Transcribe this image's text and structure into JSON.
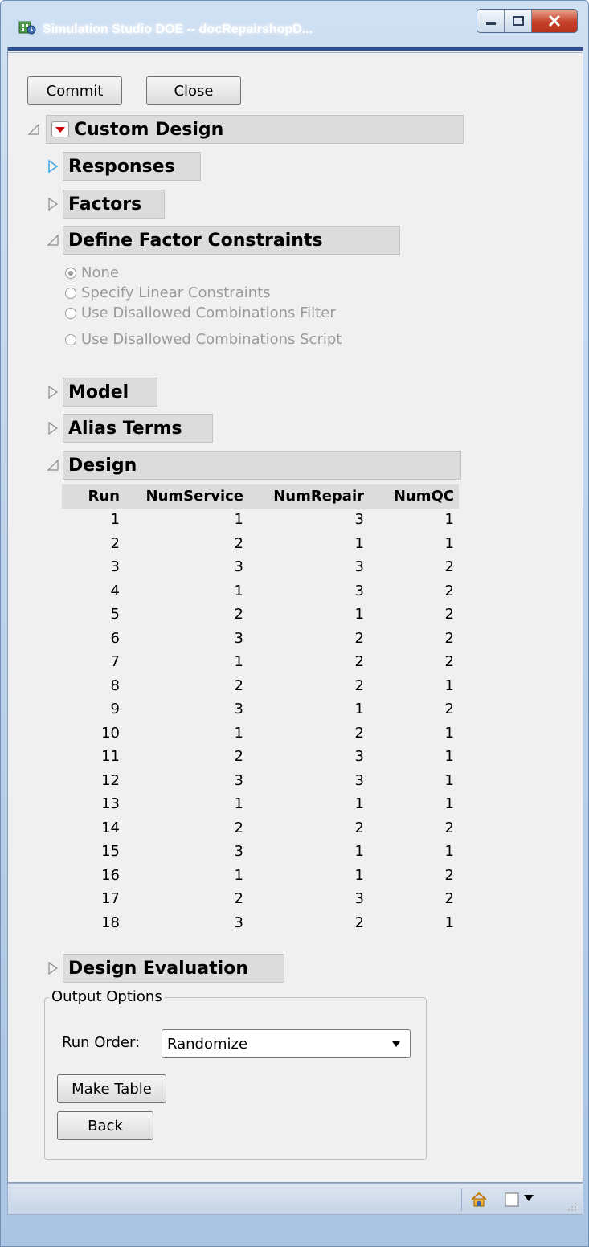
{
  "window": {
    "title": "Simulation Studio DOE -- docRepairshopD...",
    "controls": [
      "minimize",
      "maximize",
      "close"
    ],
    "accent": "#2f4f8f"
  },
  "toolbar": {
    "commit_label": "Commit",
    "close_label": "Close"
  },
  "outline": {
    "custom_design": "Custom Design",
    "responses": "Responses",
    "factors": "Factors",
    "define_factor_constraints": "Define Factor Constraints",
    "constraint_options": [
      {
        "label": "None",
        "selected": true
      },
      {
        "label": "Specify Linear Constraints",
        "selected": false
      },
      {
        "label": "Use Disallowed Combinations Filter",
        "selected": false
      },
      {
        "label": "Use Disallowed Combinations Script",
        "selected": false
      }
    ],
    "model": "Model",
    "alias_terms": "Alias Terms",
    "design": "Design",
    "design_evaluation": "Design Evaluation"
  },
  "design_table": {
    "columns": [
      "Run",
      "NumService",
      "NumRepair",
      "NumQC"
    ],
    "rows": [
      [
        "1",
        "1",
        "3",
        "1"
      ],
      [
        "2",
        "2",
        "1",
        "1"
      ],
      [
        "3",
        "3",
        "3",
        "2"
      ],
      [
        "4",
        "1",
        "3",
        "2"
      ],
      [
        "5",
        "2",
        "1",
        "2"
      ],
      [
        "6",
        "3",
        "2",
        "2"
      ],
      [
        "7",
        "1",
        "2",
        "2"
      ],
      [
        "8",
        "2",
        "2",
        "1"
      ],
      [
        "9",
        "3",
        "1",
        "2"
      ],
      [
        "10",
        "1",
        "2",
        "1"
      ],
      [
        "11",
        "2",
        "3",
        "1"
      ],
      [
        "12",
        "3",
        "3",
        "1"
      ],
      [
        "13",
        "1",
        "1",
        "1"
      ],
      [
        "14",
        "2",
        "2",
        "2"
      ],
      [
        "15",
        "3",
        "1",
        "1"
      ],
      [
        "16",
        "1",
        "1",
        "2"
      ],
      [
        "17",
        "2",
        "3",
        "2"
      ],
      [
        "18",
        "3",
        "2",
        "1"
      ]
    ]
  },
  "output_options": {
    "title": "Output Options",
    "run_order_label": "Run Order:",
    "run_order_value": "Randomize",
    "make_table_label": "Make Table",
    "back_label": "Back"
  },
  "statusbar": {
    "icons": [
      "home-icon",
      "checkbox-icon",
      "dropdown-arrow-icon",
      "resize-grip-icon"
    ]
  }
}
